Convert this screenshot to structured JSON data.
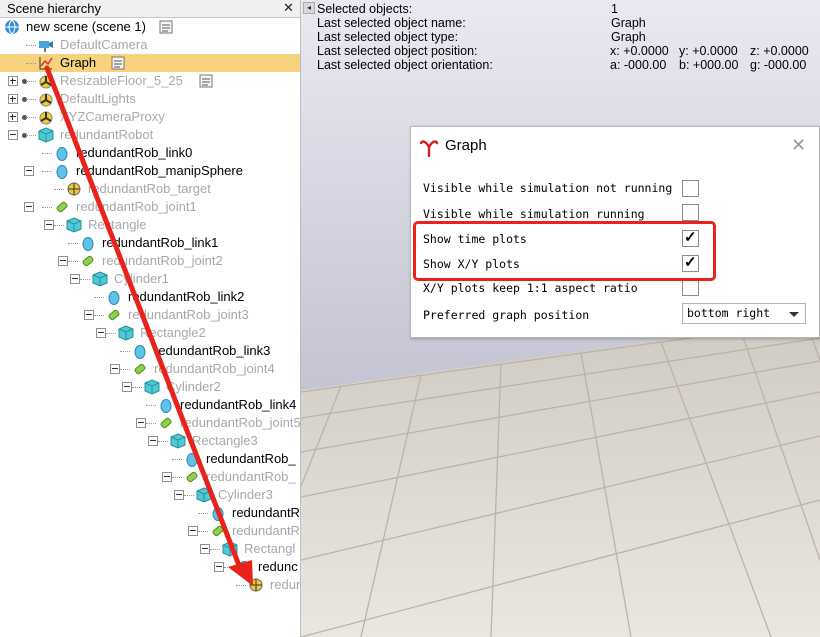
{
  "hierarchy": {
    "title": "Scene hierarchy",
    "close_glyph": "✕",
    "items": [
      {
        "label": "new scene (scene 1)",
        "grey": false,
        "icon": "globe-icon"
      },
      {
        "label": "DefaultCamera",
        "grey": true,
        "icon": "camera-icon"
      },
      {
        "label": "Graph",
        "grey": false,
        "icon": "graph-icon",
        "selected": true
      },
      {
        "label": "ResizableFloor_5_25",
        "grey": true,
        "icon": "model-icon"
      },
      {
        "label": "DefaultLights",
        "grey": true,
        "icon": "model-icon"
      },
      {
        "label": "XYZCameraProxy",
        "grey": true,
        "icon": "model-icon"
      },
      {
        "label": "redundantRobot",
        "grey": true,
        "icon": "cube-icon"
      },
      {
        "label": "redundantRob_link0",
        "grey": false,
        "icon": "shape-icon"
      },
      {
        "label": "redundantRob_manipSphere",
        "grey": false,
        "icon": "shape-icon"
      },
      {
        "label": "redundantRob_target",
        "grey": true,
        "icon": "dummy-icon"
      },
      {
        "label": "redundantRob_joint1",
        "grey": true,
        "icon": "joint-icon"
      },
      {
        "label": "Rectangle",
        "grey": true,
        "icon": "cube-icon"
      },
      {
        "label": "redundantRob_link1",
        "grey": false,
        "icon": "shape-icon"
      },
      {
        "label": "redundantRob_joint2",
        "grey": true,
        "icon": "joint-icon"
      },
      {
        "label": "Cylinder1",
        "grey": true,
        "icon": "cube-icon"
      },
      {
        "label": "redundantRob_link2",
        "grey": false,
        "icon": "shape-icon"
      },
      {
        "label": "redundantRob_joint3",
        "grey": true,
        "icon": "joint-icon"
      },
      {
        "label": "Rectangle2",
        "grey": true,
        "icon": "cube-icon"
      },
      {
        "label": "redundantRob_link3",
        "grey": false,
        "icon": "shape-icon"
      },
      {
        "label": "redundantRob_joint4",
        "grey": true,
        "icon": "joint-icon"
      },
      {
        "label": "Cylinder2",
        "grey": true,
        "icon": "cube-icon"
      },
      {
        "label": "redundantRob_link4",
        "grey": false,
        "icon": "shape-icon"
      },
      {
        "label": "redundantRob_joint5",
        "grey": true,
        "icon": "joint-icon"
      },
      {
        "label": "Rectangle3",
        "grey": true,
        "icon": "cube-icon"
      },
      {
        "label": "redundantRob_",
        "grey": false,
        "icon": "shape-icon"
      },
      {
        "label": "redundantRob_",
        "grey": true,
        "icon": "joint-icon"
      },
      {
        "label": "Cylinder3",
        "grey": true,
        "icon": "cube-icon"
      },
      {
        "label": "redundantR",
        "grey": false,
        "icon": "shape-icon"
      },
      {
        "label": "redundantR",
        "grey": true,
        "icon": "joint-icon"
      },
      {
        "label": "Rectangl",
        "grey": true,
        "icon": "cube-icon"
      },
      {
        "label": "redunc",
        "grey": false,
        "icon": "shape-icon"
      },
      {
        "label": "redun",
        "grey": true,
        "icon": "dummy-icon"
      }
    ]
  },
  "info": {
    "rows": [
      {
        "key": "Selected objects:",
        "value": "1"
      },
      {
        "key": "Last selected object name:",
        "value": "Graph"
      },
      {
        "key": "Last selected object type:",
        "value": "Graph"
      },
      {
        "key": "Last selected object position:",
        "x": "x: +0.0000",
        "y": "y: +0.0000",
        "z": "z: +0.0000"
      },
      {
        "key": "Last selected object orientation:",
        "x": "a: -000.00",
        "y": "b: +000.00",
        "z": "g: -000.00"
      }
    ]
  },
  "dialog": {
    "title": "Graph",
    "close_glyph": "✕",
    "options": [
      {
        "label": "Visible while simulation not running",
        "checked": false
      },
      {
        "label": "Visible while simulation running",
        "checked": false
      },
      {
        "label": "Show time plots",
        "checked": true
      },
      {
        "label": "Show X/Y plots",
        "checked": true
      },
      {
        "label": "X/Y plots keep 1:1 aspect ratio",
        "checked": false
      }
    ],
    "position_label": "Preferred graph position",
    "position_value": "bottom right",
    "check_glyph": "✓"
  },
  "colors": {
    "annotation": "#e8231c",
    "selection": "#f6d27c"
  }
}
